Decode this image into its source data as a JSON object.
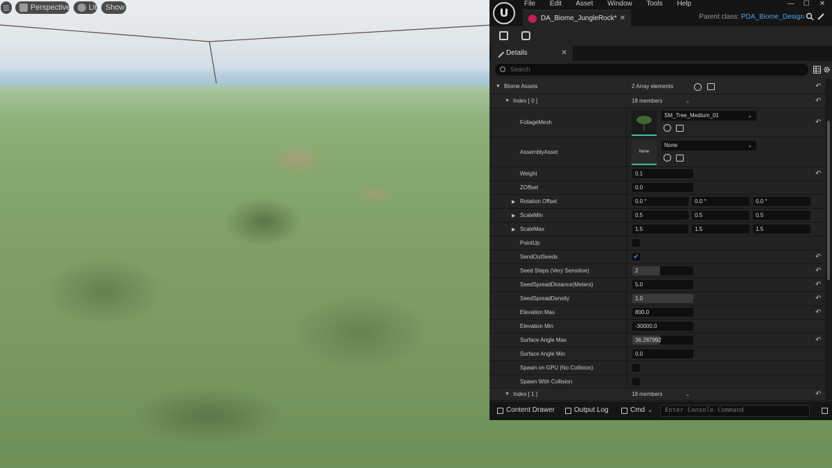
{
  "viewport": {
    "menu_icon": "hamburger-icon",
    "perspective_label": "Perspective",
    "lit_label": "Lit",
    "show_label": "Show"
  },
  "editor": {
    "logo_icon": "unreal-logo-icon",
    "menu": [
      "File",
      "Edit",
      "Asset",
      "Window",
      "Tools",
      "Help"
    ],
    "window_controls": [
      "—",
      "☐",
      "✕"
    ],
    "document_tab": "DA_Biome_JungleRock*",
    "parent_class_label": "Parent class:",
    "parent_class_value": "PDA_Biome_Design",
    "toolbar_icons": [
      "save-icon",
      "browse-asset-icon"
    ],
    "details_tab": "Details",
    "search_placeholder": "Search"
  },
  "properties": {
    "biome_assets_label": "Biome Assets",
    "biome_assets_value": "2 Array elements",
    "index0_label": "Index [ 0 ]",
    "index0_value": "18 members",
    "foliage_mesh_label": "FoliageMesh",
    "foliage_mesh_value": "SM_Tree_Medium_01",
    "assembly_asset_label": "AssemblyAsset",
    "assembly_asset_value": "None",
    "assembly_thumb_text": "None",
    "weight_label": "Weight",
    "weight_value": "0.1",
    "zoffset_label": "ZOffset",
    "zoffset_value": "0.0",
    "rotation_offset_label": "Rotation Offset",
    "rotation_offset_values": [
      "0.0 °",
      "0.0 °",
      "0.0 °"
    ],
    "scale_min_label": "ScaleMin",
    "scale_min_values": [
      "0.5",
      "0.5",
      "0.5"
    ],
    "scale_max_label": "ScaleMax",
    "scale_max_values": [
      "1.5",
      "1.5",
      "1.5"
    ],
    "point_up_label": "PointUp",
    "point_up_checked": false,
    "send_out_seeds_label": "SendOutSeeds",
    "send_out_seeds_checked": true,
    "seed_steps_label": "Seed Steps (Very Sensitive)",
    "seed_steps_value": "2",
    "seed_spread_distance_label": "SeedSpreadDistance(Meters)",
    "seed_spread_distance_value": "5.0",
    "seed_spread_density_label": "SeedSpreadDensity",
    "seed_spread_density_value": "1.0",
    "elevation_max_label": "Elevation Max",
    "elevation_max_value": "800.0",
    "elevation_min_label": "Elevation Min",
    "elevation_min_value": "-30000.0",
    "surface_angle_max_label": "Surface Angle Max",
    "surface_angle_max_value": "36.287992",
    "surface_angle_min_label": "Surface Angle Min",
    "surface_angle_min_value": "0.0",
    "spawn_on_gpu_label": "Spawn on GPU (No Collision)",
    "spawn_with_collision_label": "Spawn With Collision",
    "index1_label": "Index [ 1 ]",
    "index1_value": "18 members"
  },
  "bottom_bar": {
    "content_drawer": "Content Drawer",
    "output_log": "Output Log",
    "cmd": "Cmd",
    "console_placeholder": "Enter Console Command"
  },
  "colors": {
    "accent_blue": "#3ba0ff",
    "link_blue": "#4ea3f0",
    "tab_dot": "#c0205a",
    "thumb_underline": "#3fbfa0"
  }
}
